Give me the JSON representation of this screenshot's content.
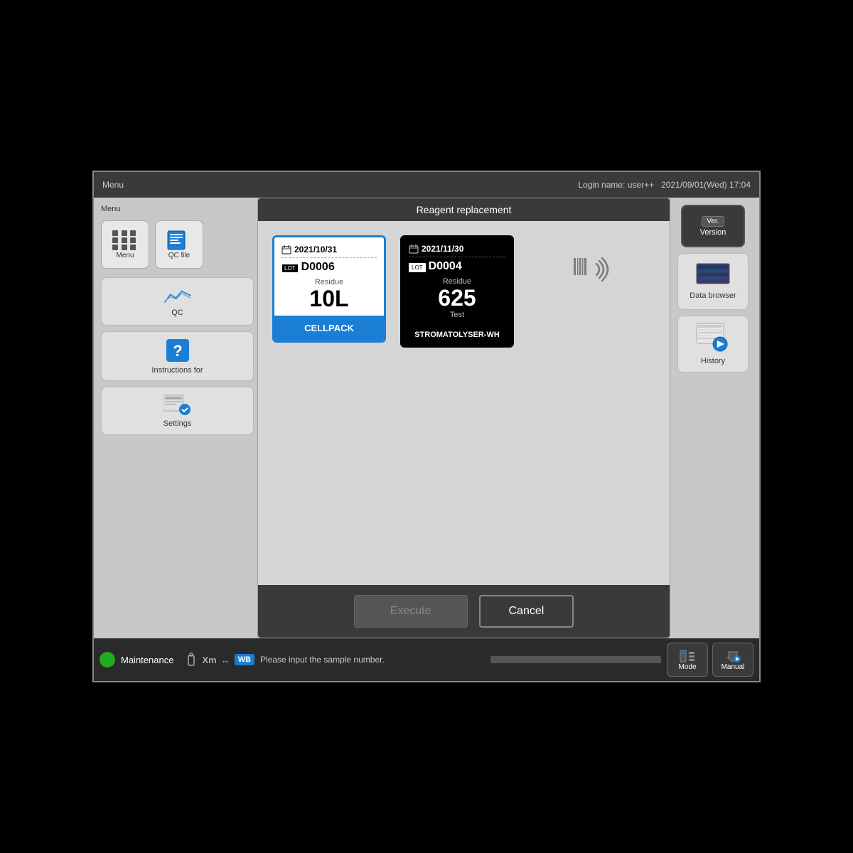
{
  "topbar": {
    "menu_label": "Menu",
    "login_user": "Login name: user++",
    "datetime": "2021/09/01(Wed) 17:04"
  },
  "modal": {
    "title": "Reagent replacement",
    "reagent1": {
      "date": "2021/10/31",
      "lot_label": "LOT",
      "lot_number": "D0006",
      "residue_label": "Residue",
      "residue_value": "10L",
      "name": "CELLPACK",
      "selected": true
    },
    "reagent2": {
      "date": "2021/11/30",
      "lot_label": "LOT",
      "lot_number": "D0004",
      "residue_label": "Residue",
      "residue_value": "625",
      "residue_unit": "Test",
      "name": "STROMATOLYSER-WH",
      "selected": false
    },
    "execute_btn": "Execute",
    "cancel_btn": "Cancel"
  },
  "sidebar_left": {
    "menu_label": "Menu",
    "menu_btn": "Menu",
    "qcfile_btn": "QC file",
    "qc_btn": "QC",
    "instructions_btn": "Instructions for",
    "settings_btn": "Settings"
  },
  "sidebar_right": {
    "version_badge": "Ver.",
    "version_label": "Version",
    "databrowser_label": "Data browser",
    "history_label": "History"
  },
  "statusbar": {
    "maintenance_label": "Maintenance",
    "wb_badge": "WB",
    "message": "Please input the sample number.",
    "mode_btn": "Mode",
    "manual_btn": "Manual"
  }
}
